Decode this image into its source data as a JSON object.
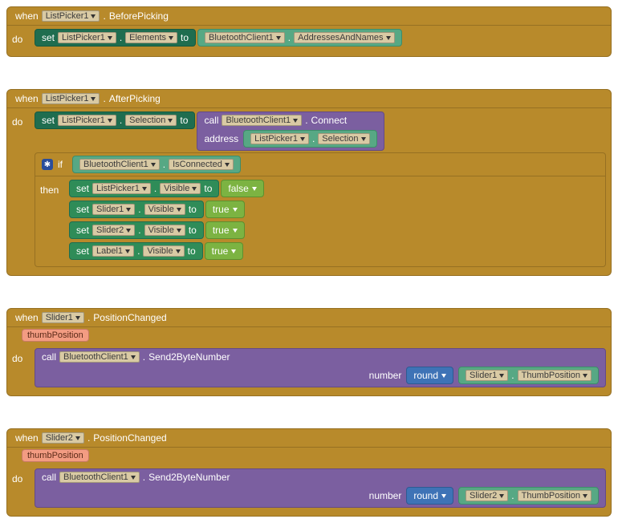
{
  "handler1": {
    "when": "when",
    "dot": ".",
    "evt": "BeforePicking",
    "comp": "ListPicker1",
    "do": "do",
    "set": "set",
    "prop": "Elements",
    "to": "to",
    "getComp": "BluetoothClient1",
    "getProp": "AddressesAndNames"
  },
  "handler2": {
    "when": "when",
    "dot": ".",
    "evt": "AfterPicking",
    "comp": "ListPicker1",
    "do": "do",
    "set": "set",
    "to": "to",
    "selComp": "ListPicker1",
    "selProp": "Selection",
    "call": "call",
    "callComp": "BluetoothClient1",
    "callMeth": "Connect",
    "argLabel": "address",
    "argComp": "ListPicker1",
    "argProp": "Selection",
    "if": "if",
    "then": "then",
    "condComp": "BluetoothClient1",
    "condProp": "IsConnected",
    "rows": [
      {
        "comp": "ListPicker1",
        "prop": "Visible",
        "val": "false"
      },
      {
        "comp": "Slider1",
        "prop": "Visible",
        "val": "true"
      },
      {
        "comp": "Slider2",
        "prop": "Visible",
        "val": "true"
      },
      {
        "comp": "Label1",
        "prop": "Visible",
        "val": "true"
      }
    ]
  },
  "handler3": {
    "when": "when",
    "dot": ".",
    "evt": "PositionChanged",
    "comp": "Slider1",
    "param": "thumbPosition",
    "do": "do",
    "call": "call",
    "callComp": "BluetoothClient1",
    "callMeth": "Send2ByteNumber",
    "argLabel": "number",
    "round": "round",
    "getComp": "Slider1",
    "getProp": "ThumbPosition"
  },
  "handler4": {
    "when": "when",
    "dot": ".",
    "evt": "PositionChanged",
    "comp": "Slider2",
    "param": "thumbPosition",
    "do": "do",
    "call": "call",
    "callComp": "BluetoothClient1",
    "callMeth": "Send2ByteNumber",
    "argLabel": "number",
    "round": "round",
    "getComp": "Slider2",
    "getProp": "ThumbPosition"
  }
}
